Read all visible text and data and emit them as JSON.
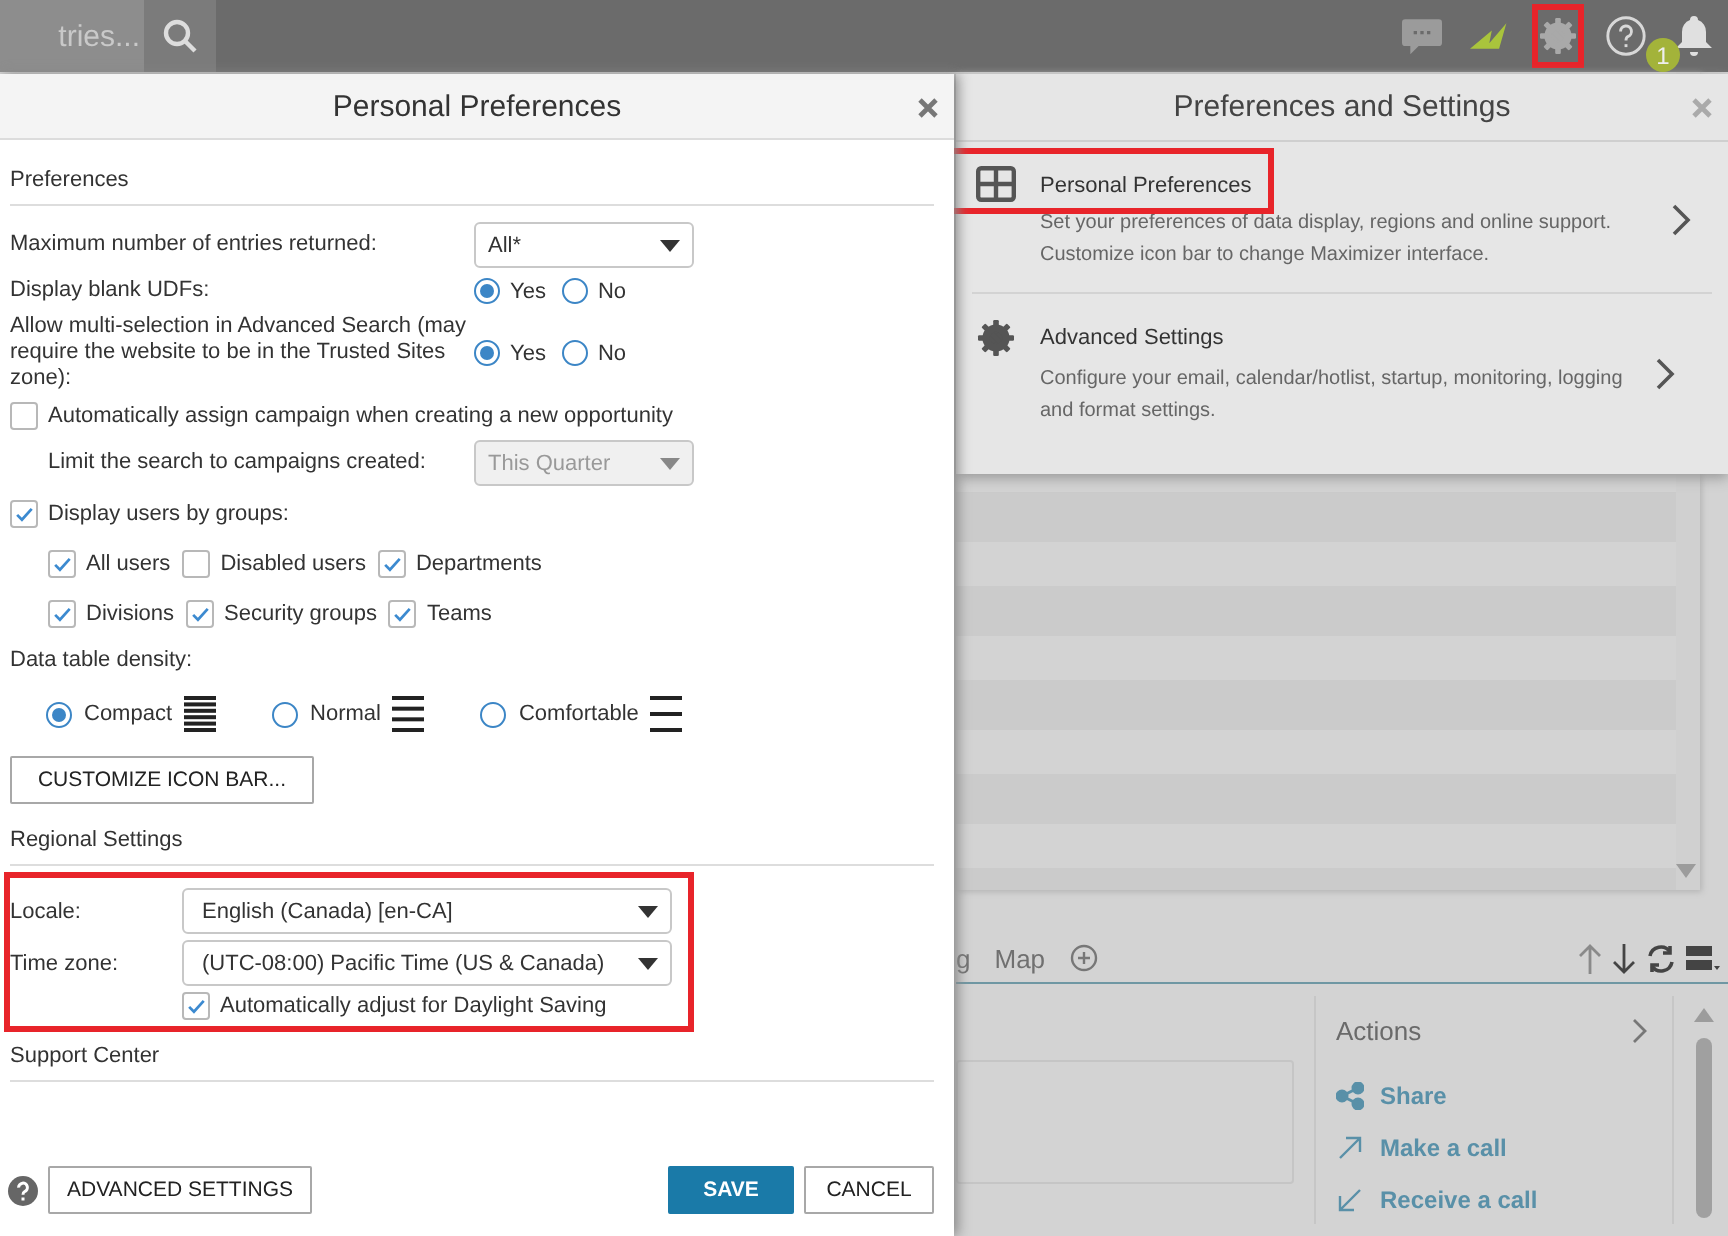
{
  "topbar": {
    "search": {
      "placeholder": "tries..."
    },
    "icons": [
      {
        "kind": "chat",
        "highlighted": false
      },
      {
        "kind": "logo",
        "highlighted": false
      },
      {
        "kind": "settings",
        "highlighted": true
      },
      {
        "kind": "help",
        "highlighted": false
      },
      {
        "kind": "notifications",
        "highlighted": false,
        "badge": "1"
      }
    ]
  },
  "background": {
    "tabs": [
      {
        "label": "g"
      },
      {
        "label": "Map"
      }
    ],
    "actions": {
      "title": "Actions",
      "items": [
        {
          "kind": "share",
          "label": "Share"
        },
        {
          "kind": "outgoing",
          "label": "Make a call"
        },
        {
          "kind": "incoming",
          "label": "Receive a call"
        }
      ]
    }
  },
  "settings_panel": {
    "title": "Preferences and Settings",
    "items": [
      {
        "kind": "grid",
        "title": "Personal Preferences",
        "description": "Set your preferences of data display, regions and online support. Customize icon bar to change Maximizer interface.",
        "highlighted": true
      },
      {
        "kind": "gear",
        "title": "Advanced Settings",
        "description": "Configure your email, calendar/hotlist, startup, monitoring, logging and format settings.",
        "highlighted": false
      }
    ]
  },
  "dialog": {
    "title": "Personal Preferences",
    "preferences": {
      "heading": "Preferences",
      "max_entries": {
        "label": "Maximum number of entries returned:",
        "value": "All*",
        "disabled": false
      },
      "blank_udfs": {
        "label": "Display blank UDFs:",
        "options": [
          {
            "label": "Yes",
            "selected": true
          },
          {
            "label": "No",
            "selected": false
          }
        ]
      },
      "multi_selection": {
        "label": "Allow multi-selection in Advanced Search (may require the website to be in the Trusted Sites zone):",
        "options": [
          {
            "label": "Yes",
            "selected": true
          },
          {
            "label": "No",
            "selected": false
          }
        ]
      },
      "auto_assign": {
        "label": "Automatically assign campaign when creating a new opportunity",
        "checked": false
      },
      "limit_search": {
        "label": "Limit the search to campaigns created:",
        "value": "This Quarter",
        "disabled": true
      },
      "display_users": {
        "label": "Display users by groups:",
        "checked": true,
        "groups": [
          [
            {
              "label": "All users",
              "checked": true
            },
            {
              "label": "Disabled users",
              "checked": false
            },
            {
              "label": "Departments",
              "checked": true
            }
          ],
          [
            {
              "label": "Divisions",
              "checked": true
            },
            {
              "label": "Security groups",
              "checked": true
            },
            {
              "label": "Teams",
              "checked": true
            }
          ]
        ]
      },
      "density": {
        "label": "Data table density:",
        "options": [
          {
            "kind": "compact",
            "label": "Compact",
            "selected": true
          },
          {
            "kind": "normal",
            "label": "Normal",
            "selected": false
          },
          {
            "kind": "comfortable",
            "label": "Comfortable",
            "selected": false
          }
        ]
      },
      "customize_button": "CUSTOMIZE ICON BAR..."
    },
    "regional": {
      "heading": "Regional Settings",
      "highlighted": true,
      "locale": {
        "label": "Locale:",
        "value": "English (Canada) [en-CA]",
        "disabled": false
      },
      "time_zone": {
        "label": "Time zone:",
        "value": "(UTC-08:00) Pacific Time (US & Canada)",
        "disabled": false
      },
      "daylight": {
        "label": "Automatically adjust for Daylight Saving",
        "checked": true
      }
    },
    "support": {
      "heading": "Support Center"
    },
    "footer": {
      "advanced_button": "ADVANCED SETTINGS",
      "save_button": "SAVE",
      "cancel_button": "CANCEL"
    }
  }
}
